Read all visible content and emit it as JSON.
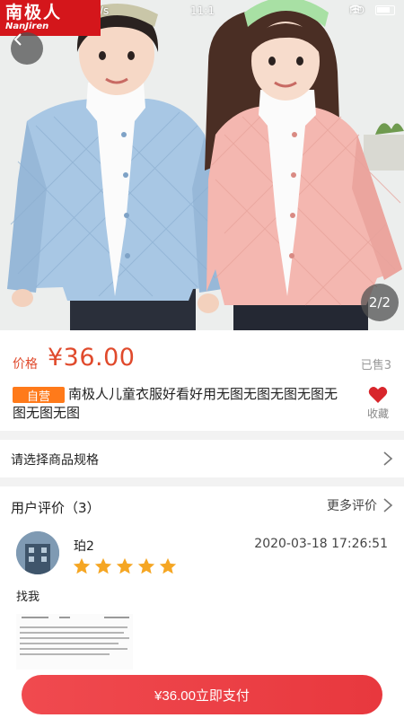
{
  "status_bar": {
    "speed": "6.9K/s",
    "time": "11:1",
    "network": "HD",
    "battery_icon": "battery-icon"
  },
  "brand": {
    "logo_main": "南极人",
    "logo_sub": "NanJiren",
    "color": "#d4161b"
  },
  "gallery": {
    "pager": "2/2"
  },
  "product": {
    "price_label": "价格",
    "price": "¥36.00",
    "sold": "已售3",
    "badge": "自营",
    "title": "南极人儿童衣服好看好用无图无图无图无图无图无图无图",
    "favorite_label": "收藏",
    "accent_color": "#e04a2c"
  },
  "spec": {
    "label": "请选择商品规格"
  },
  "reviews": {
    "title": "用户评价（3）",
    "more": "更多评价",
    "items": [
      {
        "user": "珀2",
        "date": "2020-03-18 17:26:51",
        "rating": 5,
        "text": "找我"
      }
    ]
  },
  "footer": {
    "pay_label": "¥36.00立即支付",
    "pay_color": "#ee4147"
  }
}
